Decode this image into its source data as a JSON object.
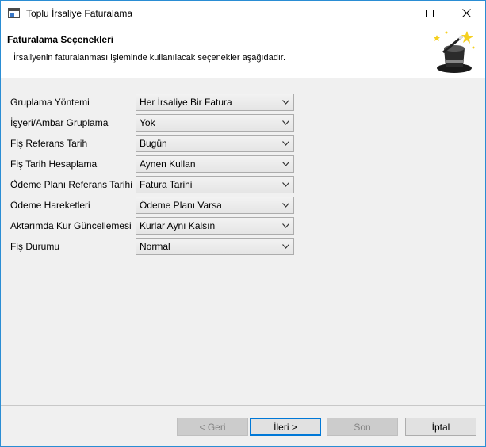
{
  "window": {
    "title": "Toplu İrsaliye Faturalama"
  },
  "header": {
    "title": "Faturalama Seçenekleri",
    "description": "İrsaliyenin faturalanması işleminde kullanılacak seçenekler aşağıdadır.",
    "icon": "magic-wand-hat-icon"
  },
  "form": {
    "rows": [
      {
        "label": "Gruplama Yöntemi",
        "value": "Her İrsaliye Bir Fatura"
      },
      {
        "label": "İşyeri/Ambar Gruplama",
        "value": "Yok"
      },
      {
        "label": "Fiş Referans Tarih",
        "value": "Bugün"
      },
      {
        "label": "Fiş Tarih Hesaplama",
        "value": "Aynen Kullan"
      },
      {
        "label": "Ödeme Planı Referans Tarihi",
        "value": "Fatura Tarihi"
      },
      {
        "label": "Ödeme Hareketleri",
        "value": "Ödeme Planı Varsa"
      },
      {
        "label": "Aktarımda Kur Güncellemesi",
        "value": "Kurlar Aynı Kalsın"
      },
      {
        "label": "Fiş Durumu",
        "value": "Normal"
      }
    ]
  },
  "buttons": {
    "back": "< Geri",
    "next": "İleri >",
    "finish": "Son",
    "cancel": "İptal"
  },
  "colors": {
    "window_border": "#2a8dd4",
    "default_button_border": "#0078d7"
  }
}
